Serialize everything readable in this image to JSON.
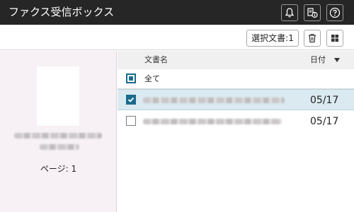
{
  "header": {
    "title": "ファクス受信ボックス",
    "icons": [
      "bell-icon",
      "fax-info-icon",
      "help-icon"
    ]
  },
  "toolbar": {
    "select_docs_label": "選択文書:1",
    "icons": [
      "trash-icon",
      "grid-view-icon"
    ]
  },
  "preview": {
    "page_label": "ページ: 1"
  },
  "list": {
    "columns": {
      "name": "文書名",
      "date": "日付"
    },
    "select_all_label": "全て",
    "rows": [
      {
        "date": "05/17",
        "selected": true
      },
      {
        "date": "05/17",
        "selected": false
      }
    ]
  },
  "colors": {
    "header_bg": "#262626",
    "accent": "#1a6b8c",
    "selected_row": "#daeaf0",
    "preview_bg": "#f7f1f5"
  }
}
